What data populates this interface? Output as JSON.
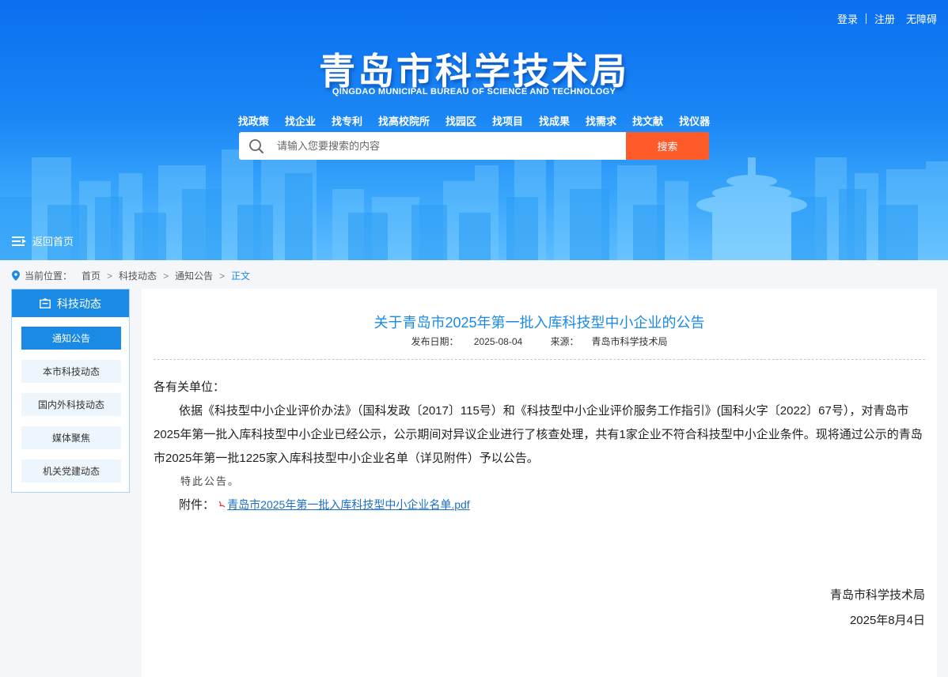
{
  "header": {
    "top_links": [
      "登录",
      "注册",
      "无障碍"
    ],
    "site_title": "青岛市科学技术局",
    "site_subtitle": "QINGDAO MUNICIPAL BUREAU OF SCIENCE AND TECHNOLOGY",
    "nav": [
      "找政策",
      "找企业",
      "找专利",
      "找高校院所",
      "找园区",
      "找项目",
      "找成果",
      "找需求",
      "找文献",
      "找仪器"
    ],
    "search": {
      "placeholder": "请输入您要搜索的内容",
      "button": "搜索"
    },
    "back_home": "返回首页"
  },
  "breadcrumb": {
    "label": "当前位置：",
    "items": [
      "首页",
      "科技动态",
      "通知公告"
    ],
    "current": "正文"
  },
  "sidebar": {
    "title": "科技动态",
    "items": [
      {
        "label": "通知公告",
        "active": true
      },
      {
        "label": "本市科技动态",
        "active": false
      },
      {
        "label": "国内外科技动态",
        "active": false
      },
      {
        "label": "媒体聚焦",
        "active": false
      },
      {
        "label": "机关党建动态",
        "active": false
      }
    ]
  },
  "article": {
    "title": "关于青岛市2025年第一批入库科技型中小企业的公告",
    "publish_label": "发布日期：",
    "publish_date": "2025-08-04",
    "source_label": "来源：",
    "source": "青岛市科学技术局",
    "salutation": "各有关单位：",
    "paragraph": "依据《科技型中小企业评价办法》（国科发政〔2017〕115号）和《科技型中小企业评价服务工作指引》(国科火字〔2022〕67号），对青岛市2025年第一批入库科技型中小企业已经公示，公示期间对异议企业进行了核查处理，共有1家企业不符合科技型中小企业条件。现将通过公示的青岛市2025年第一批1225家入库科技型中小企业名单（详见附件）予以公告。",
    "closing": "特此公告。",
    "attachment_label": "附件：",
    "attachment_name": "青岛市2025年第一批入库科技型中小企业名单.pdf",
    "signature_org": "青岛市科学技术局",
    "signature_date": "2025年8月4日"
  },
  "colors": {
    "primary": "#1a8ae5",
    "search_button": "#ff5a2a",
    "banner_top": "#0a6ff0"
  }
}
